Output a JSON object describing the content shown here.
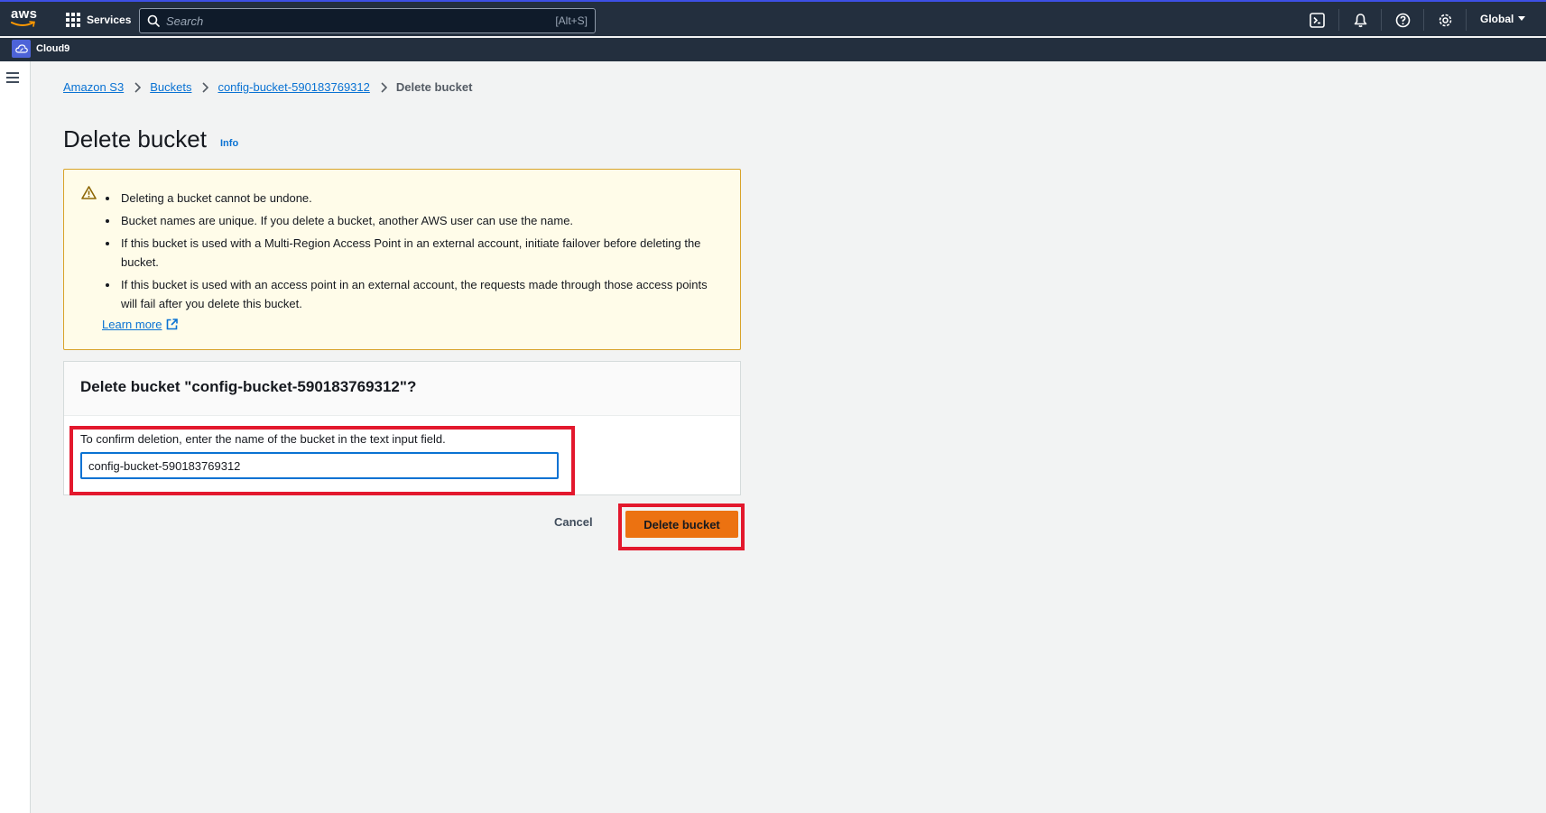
{
  "topnav": {
    "logo_text": "aws",
    "services_label": "Services",
    "search_placeholder": "Search",
    "search_shortcut": "[Alt+S]",
    "region_label": "Global"
  },
  "subnav": {
    "service_name": "Cloud9"
  },
  "breadcrumb": {
    "items": [
      "Amazon S3",
      "Buckets",
      "config-bucket-590183769312"
    ],
    "current": "Delete bucket"
  },
  "page": {
    "title": "Delete bucket",
    "info_label": "Info"
  },
  "warning": {
    "items": [
      "Deleting a bucket cannot be undone.",
      "Bucket names are unique. If you delete a bucket, another AWS user can use the name.",
      "If this bucket is used with a Multi-Region Access Point in an external account, initiate failover before deleting the bucket.",
      "If this bucket is used with an access point in an external account, the requests made through those access points will fail after you delete this bucket."
    ],
    "learn_more": "Learn more"
  },
  "confirm": {
    "title": "Delete bucket \"config-bucket-590183769312\"?",
    "label": "To confirm deletion, enter the name of the bucket in the text input field.",
    "value": "config-bucket-590183769312"
  },
  "actions": {
    "cancel_label": "Cancel",
    "delete_label": "Delete bucket"
  },
  "colors": {
    "nav_bg": "#232f3e",
    "link": "#0972d3",
    "warning_bg": "#fffce9",
    "warning_border": "#d8a32a",
    "primary_button": "#ec7211",
    "annotation": "#e3182d"
  }
}
